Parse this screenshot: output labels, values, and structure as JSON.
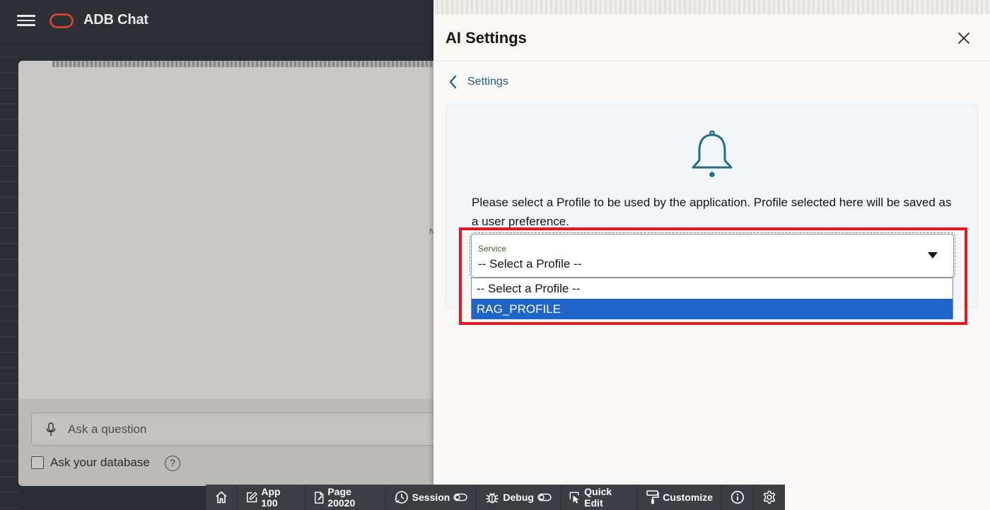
{
  "app": {
    "title": "ADB Chat",
    "brand_color": "#c74634"
  },
  "chat": {
    "ask_placeholder": "Ask a question",
    "ask_database_label": "Ask your database",
    "ask_database_checked": false,
    "help_glyph": "?",
    "marker_text": "N"
  },
  "drawer": {
    "title": "AI Settings",
    "close_icon": "close-icon",
    "back_label": "Settings",
    "message": "Please select a Profile to be used by the application. Profile selected here will be saved as a user preference.",
    "select": {
      "label": "Service",
      "value": "-- Select a Profile --",
      "options": [
        "-- Select a Profile --",
        "RAG_PROFILE"
      ],
      "highlighted_option": "RAG_PROFILE"
    },
    "accent_color": "#1d5f79",
    "highlight_color": "#e8161e",
    "option_highlight_color": "#1f65c9"
  },
  "dev_toolbar": {
    "items": [
      {
        "icon": "home-icon",
        "label": ""
      },
      {
        "icon": "edit-icon",
        "label": "App 100"
      },
      {
        "icon": "page-edit-icon",
        "label": "Page 20020"
      },
      {
        "icon": "session-icon",
        "label": "Session"
      },
      {
        "icon": "bug-icon",
        "label": "Debug"
      },
      {
        "icon": "quick-edit-icon",
        "label": "Quick Edit"
      },
      {
        "icon": "paint-roller-icon",
        "label": "Customize"
      },
      {
        "icon": "info-icon",
        "label": ""
      },
      {
        "icon": "gear-icon",
        "label": ""
      }
    ]
  }
}
